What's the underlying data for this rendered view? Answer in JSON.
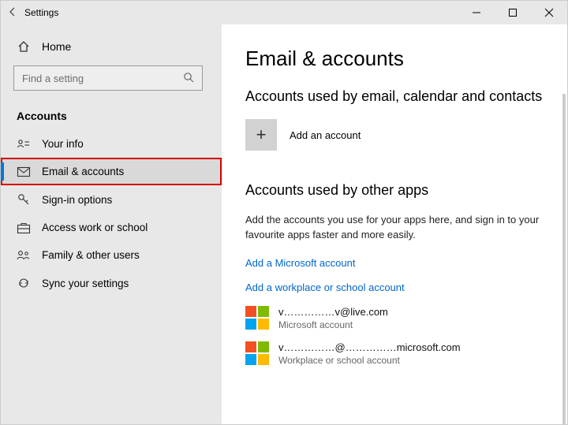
{
  "window": {
    "title": "Settings"
  },
  "home_label": "Home",
  "search": {
    "placeholder": "Find a setting"
  },
  "category_label": "Accounts",
  "nav": {
    "items": [
      {
        "label": "Your info"
      },
      {
        "label": "Email & accounts"
      },
      {
        "label": "Sign-in options"
      },
      {
        "label": "Access work or school"
      },
      {
        "label": "Family & other users"
      },
      {
        "label": "Sync your settings"
      }
    ],
    "selected_index": 1,
    "highlight_index": 1
  },
  "page": {
    "title": "Email & accounts",
    "section1_title": "Accounts used by email, calendar and contacts",
    "add_account_label": "Add an account",
    "add_symbol": "+",
    "section2_title": "Accounts used by other apps",
    "section2_desc": "Add the accounts you use for your apps here, and sign in to your favourite apps faster and more easily.",
    "link_ms": "Add a Microsoft account",
    "link_work": "Add a workplace or school account",
    "accounts": [
      {
        "email": "v……………v@live.com",
        "type": "Microsoft account"
      },
      {
        "email": "v……………@……………microsoft.com",
        "type": "Workplace or school account"
      }
    ]
  }
}
